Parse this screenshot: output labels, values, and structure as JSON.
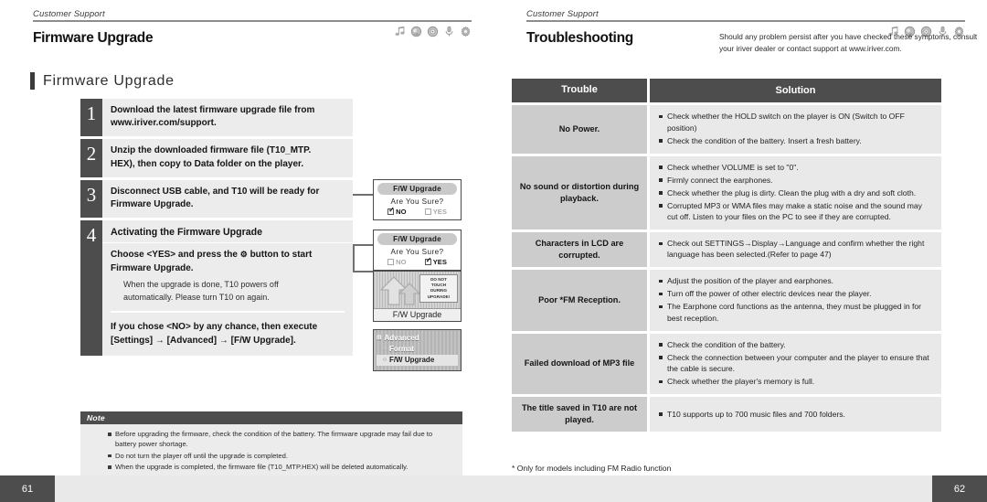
{
  "left_page": {
    "running_header": {
      "kicker": "Customer Support",
      "icons": [
        "music-note-icon",
        "text-viewer-icon",
        "fm-radio-icon",
        "voice-recorder-icon",
        "settings-gear-icon"
      ]
    },
    "chapter_title": "Firmware Upgrade",
    "section_heading": "Firmware Upgrade",
    "steps": [
      {
        "number": "1",
        "lines": [
          "Download the latest firmware upgrade file from",
          "www.iriver.com/support."
        ]
      },
      {
        "number": "2",
        "lines": [
          "Unzip the downloaded firmware file (T10_MTP.",
          "HEX), then copy to Data folder on the player."
        ]
      },
      {
        "number": "3",
        "lines": [
          "Disconnect USB cable, and T10 will be ready for",
          "Firmware Upgrade."
        ]
      }
    ],
    "step4": {
      "number": "4",
      "title": "Activating the Firmware Upgrade",
      "bold_lead": "Choose <YES> and press the",
      "bold_glyph": "⚙",
      "bold_tail": "button to start",
      "bold_line2": "Firmware Upgrade.",
      "sub_line1": "When the upgrade is done, T10 powers off",
      "sub_line2": "automatically. Please turn T10 on again.",
      "foot_line1": "If you chose <NO> by any chance, then execute",
      "foot_line2": "[Settings] → [Advanced] → [F/W Upgrade]."
    },
    "device_screens": {
      "dialog_no": {
        "title": "F/W Upgrade",
        "question": "Are You Sure?",
        "options": [
          {
            "label": "NO",
            "checked": true
          },
          {
            "label": "YES",
            "checked": false
          }
        ]
      },
      "dialog_yes": {
        "title": "F/W Upgrade",
        "question": "Are You Sure?",
        "options": [
          {
            "label": "NO",
            "checked": false
          },
          {
            "label": "YES",
            "checked": true
          }
        ]
      },
      "progress": {
        "bubble_lines": [
          "DO NOT",
          "TOUCH",
          "DURING",
          "UPGRADE!"
        ],
        "label": "F/W Upgrade"
      },
      "settings_menu": {
        "root": "Advanced",
        "items": [
          "Format",
          "F/W Upgrade"
        ],
        "selected": "F/W Upgrade"
      }
    },
    "note": {
      "title": "Note",
      "items": [
        "Before upgrading the firmware, check the condition of the battery. The firmware upgrade may fail due to battery power shortage.",
        "Do not turn the player off until the upgrade is completed.",
        "When the upgrade is completed, the firmware file (T10_MTP.HEX) will be deleted automatically."
      ]
    },
    "page_number": "61"
  },
  "right_page": {
    "running_header": {
      "kicker": "Customer Support",
      "icons": [
        "music-note-icon",
        "text-viewer-icon",
        "fm-radio-icon",
        "voice-recorder-icon",
        "settings-gear-icon"
      ]
    },
    "chapter_title": "Troubleshooting",
    "intro": "Should any problem persist after you have checked these symptoms, consult your iriver dealer or contact support at www.iriver.com.",
    "table": {
      "headers": {
        "trouble": "Trouble",
        "solution": "Solution"
      },
      "rows": [
        {
          "trouble": "No Power.",
          "solutions": [
            "Check whether the HOLD switch on the player is ON (Switch to OFF position)",
            "Check the condition of the battery. Insert a fresh battery."
          ]
        },
        {
          "trouble": "No sound or distortion during playback.",
          "solutions": [
            "Check whether VOLUME is set to \"0\".",
            "Firmly connect the earphones.",
            "Check whether the plug is dirty. Clean the plug with a dry and soft cloth.",
            "Corrupted MP3 or WMA files may make a static noise and the sound may cut off. Listen to your files on the PC to see if they are corrupted."
          ]
        },
        {
          "trouble": "Characters in LCD are corrupted.",
          "solutions": [
            "Check out SETTINGS→Display→Language and confirm whether the right language has been selected.(Refer to page 47)"
          ]
        },
        {
          "trouble": "Poor *FM Reception.",
          "solutions": [
            "Adjust the position of the player and earphones.",
            "Turn off the power of other electric devices near the player.",
            "The Earphone cord functions as the antenna, they must be plugged in for best reception."
          ]
        },
        {
          "trouble": "Failed download of MP3 file",
          "solutions": [
            "Check the condition of the battery.",
            "Check the connection between your computer and the player to ensure that the cable is secure.",
            "Check whether the player's memory is full."
          ]
        },
        {
          "trouble": "The title saved in T10 are not played.",
          "solutions": [
            "T10 supports up to 700 music files and 700 folders."
          ]
        }
      ]
    },
    "footnote": "* Only for models including FM Radio function",
    "page_number": "62"
  },
  "colors": {
    "dark_gray": "#4d4d4d",
    "mid_gray": "#cccccc",
    "light_gray": "#e9e9e9",
    "rule_gray": "#8d8d8d"
  }
}
